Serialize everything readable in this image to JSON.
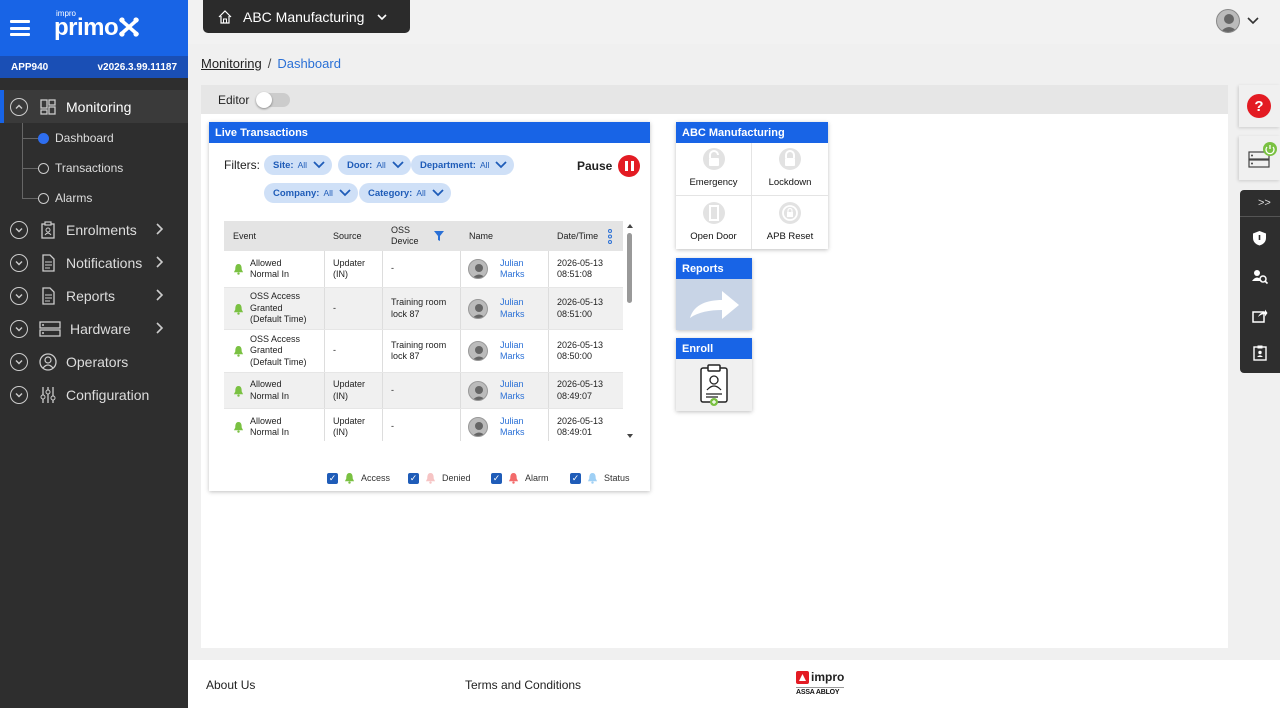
{
  "app": {
    "logo_small": "impro",
    "logo_big": "primo",
    "app_id": "APP940",
    "version": "v2026.3.99.11187"
  },
  "site_selector": {
    "label": "ABC Manufacturing"
  },
  "sidebar": {
    "items": [
      {
        "label": "Monitoring"
      },
      {
        "label": "Enrolments"
      },
      {
        "label": "Notifications"
      },
      {
        "label": "Reports"
      },
      {
        "label": "Hardware"
      },
      {
        "label": "Operators"
      },
      {
        "label": "Configuration"
      }
    ],
    "monitoring_sub": [
      "Dashboard",
      "Transactions",
      "Alarms"
    ]
  },
  "breadcrumb": {
    "parent": "Monitoring",
    "current": "Dashboard"
  },
  "editor": {
    "label": "Editor"
  },
  "live_transactions": {
    "title": "Live Transactions",
    "filters_label": "Filters:",
    "filters": [
      {
        "name": "Site:",
        "value": "All"
      },
      {
        "name": "Door:",
        "value": "All"
      },
      {
        "name": "Department:",
        "value": "All"
      },
      {
        "name": "Company:",
        "value": "All"
      },
      {
        "name": "Category:",
        "value": "All"
      }
    ],
    "pause_label": "Pause",
    "columns": {
      "event": "Event",
      "source": "Source",
      "oss_device_1": "OSS",
      "oss_device_2": "Device",
      "name": "Name",
      "datetime": "Date/Time"
    },
    "rows": [
      {
        "event": [
          "Allowed",
          "Normal In"
        ],
        "source": [
          "Updater",
          "(IN)"
        ],
        "device": [
          "-"
        ],
        "name": [
          "Julian",
          "Marks"
        ],
        "date": "2026-05-13",
        "time": "08:51:08"
      },
      {
        "event": [
          "OSS Access",
          "Granted",
          "(Default Time)"
        ],
        "source": [
          "-"
        ],
        "device": [
          "Training room",
          "lock 87"
        ],
        "name": [
          "Julian",
          "Marks"
        ],
        "date": "2026-05-13",
        "time": "08:51:00"
      },
      {
        "event": [
          "OSS Access",
          "Granted",
          "(Default Time)"
        ],
        "source": [
          "-"
        ],
        "device": [
          "Training room",
          "lock 87"
        ],
        "name": [
          "Julian",
          "Marks"
        ],
        "date": "2026-05-13",
        "time": "08:50:00"
      },
      {
        "event": [
          "Allowed",
          "Normal In"
        ],
        "source": [
          "Updater",
          "(IN)"
        ],
        "device": [
          "-"
        ],
        "name": [
          "Julian",
          "Marks"
        ],
        "date": "2026-05-13",
        "time": "08:49:07"
      },
      {
        "event": [
          "Allowed",
          "Normal In"
        ],
        "source": [
          "Updater",
          "(IN)"
        ],
        "device": [
          "-"
        ],
        "name": [
          "Julian",
          "Marks"
        ],
        "date": "2026-05-13",
        "time": "08:49:01"
      }
    ],
    "legend": [
      "Access",
      "Denied",
      "Alarm",
      "Status"
    ]
  },
  "abc_widget": {
    "title": "ABC Manufacturing",
    "buttons": [
      "Emergency",
      "Lockdown",
      "Open Door",
      "APB Reset"
    ]
  },
  "reports_widget": {
    "title": "Reports"
  },
  "enroll_widget": {
    "title": "Enroll"
  },
  "footer": {
    "about": "About Us",
    "terms": "Terms and Conditions",
    "brand": "impro",
    "brand_sub": "ASSA ABLOY"
  },
  "right_panel": {
    "expand_label": ">>",
    "help_label": "?"
  },
  "colors": {
    "primary": "#1864e6",
    "sidebar_bg": "#2e2e2e",
    "access": "#7ac142",
    "denied": "#f6c4c4",
    "alarm": "#f36b6b",
    "status": "#9fd0f5",
    "pause": "#e31b23"
  }
}
